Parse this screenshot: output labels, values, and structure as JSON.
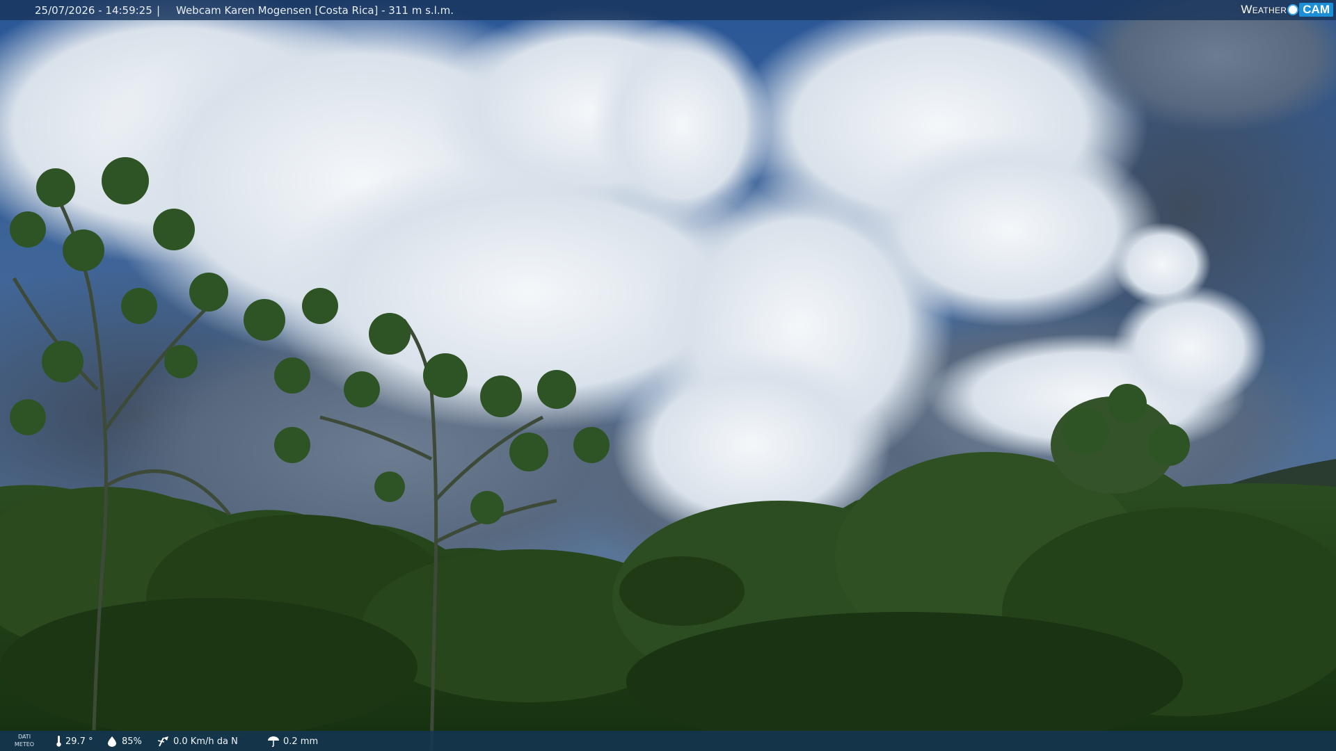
{
  "header": {
    "datetime": "25/07/2026 - 14:59:25",
    "separator": "|",
    "title": "Webcam Karen Mogensen [Costa Rica]  - 311 m s.l.m."
  },
  "logo": {
    "text_weather": "Weather",
    "text_cam": "CAM"
  },
  "footer": {
    "dati_label_1": "DATI",
    "dati_label_2": "METEO",
    "temperature": "29.7 °",
    "humidity": "85%",
    "wind": "0.0 Km/h da N",
    "rain": "0.2 mm",
    "icons": [
      "thermometer-icon",
      "humidity-icon",
      "wind-icon",
      "rain-icon"
    ]
  },
  "colors": {
    "sky": "#2f5fa0",
    "cloud": "#e9eef4",
    "forest": "#1f3f18",
    "bar": "#173a5c"
  }
}
